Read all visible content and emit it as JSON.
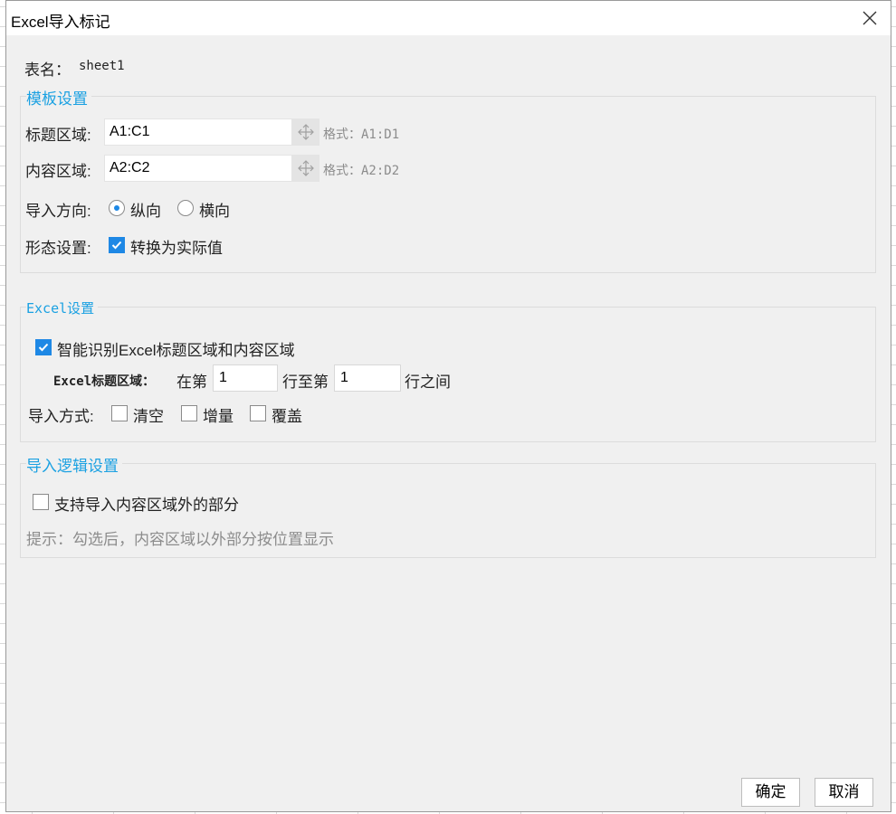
{
  "window": {
    "title": "Excel导入标记"
  },
  "sheet": {
    "label": "表名：",
    "name": "sheet1"
  },
  "template": {
    "legend": "模板设置",
    "title_area": {
      "label": "标题区域:",
      "value": "A1:C1",
      "hint": "格式：A1:D1"
    },
    "content_area": {
      "label": "内容区域:",
      "value": "A2:C2",
      "hint": "格式：A2:D2"
    },
    "direction": {
      "label": "导入方向:",
      "options": [
        {
          "label": "纵向",
          "selected": true
        },
        {
          "label": "横向",
          "selected": false
        }
      ]
    },
    "form": {
      "label": "形态设置:",
      "checkbox_label": "转换为实际值",
      "checked": true
    }
  },
  "excel": {
    "legend": "Excel设置",
    "smart": {
      "label": "智能识别Excel标题区域和内容区域",
      "checked": true
    },
    "title_range": {
      "label": "Excel标题区域：",
      "prefix": "在第",
      "from": "1",
      "middle": "行至第",
      "to": "1",
      "suffix": "行之间"
    },
    "mode": {
      "label": "导入方式:",
      "options": [
        {
          "label": "清空",
          "checked": false
        },
        {
          "label": "增量",
          "checked": false
        },
        {
          "label": "覆盖",
          "checked": false
        }
      ]
    }
  },
  "logic": {
    "legend": "导入逻辑设置",
    "support": {
      "label": "支持导入内容区域外的部分",
      "checked": false
    },
    "tip": "提示：勾选后，内容区域以外部分按位置显示"
  },
  "footer": {
    "ok": "确定",
    "cancel": "取消"
  },
  "colors": {
    "accent": "#1ba1e2",
    "check": "#1e88e5",
    "hint": "#8c8c8c"
  },
  "icons": {
    "close": "close-icon",
    "move": "move-arrows-icon",
    "check": "checkmark-icon"
  }
}
